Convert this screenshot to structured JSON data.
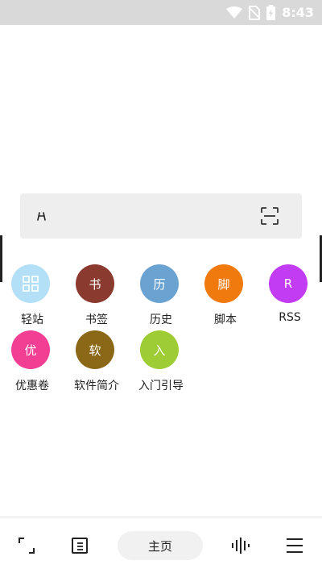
{
  "status_bar": {
    "time": "8:43"
  },
  "search": {
    "placeholder": ""
  },
  "shortcuts": [
    {
      "label": "轻站",
      "glyph": "",
      "color": "#b3e0f7",
      "icon": "grid-apps-icon"
    },
    {
      "label": "书签",
      "glyph": "书",
      "color": "#8b3a2f"
    },
    {
      "label": "历史",
      "glyph": "历",
      "color": "#6aa3d2"
    },
    {
      "label": "脚本",
      "glyph": "脚",
      "color": "#f07a0e"
    },
    {
      "label": "RSS",
      "glyph": "R",
      "color": "#c13cf2"
    },
    {
      "label": "优惠卷",
      "glyph": "优",
      "color": "#f23f94"
    },
    {
      "label": "软件简介",
      "glyph": "软",
      "color": "#8b6718"
    },
    {
      "label": "入门引导",
      "glyph": "入",
      "color": "#9dcc35"
    }
  ],
  "bottom_bar": {
    "home_label": "主页"
  }
}
